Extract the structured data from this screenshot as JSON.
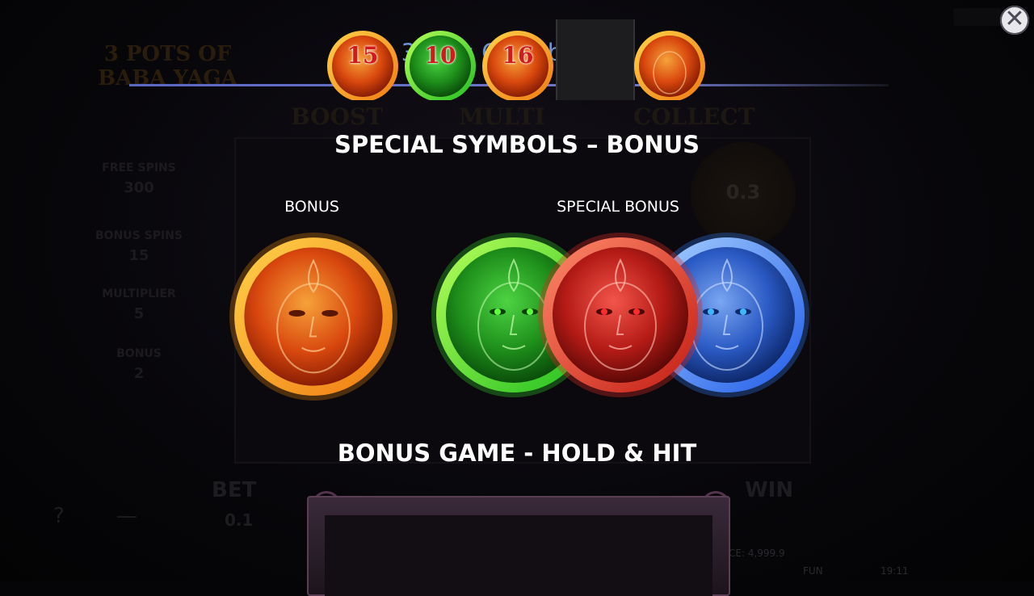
{
  "modal": {
    "title": "3 Pots Of BabaYaga",
    "close_icon": "close-icon",
    "section_title": "SPECIAL SYMBOLS – BONUS",
    "bonus_label": "BONUS",
    "special_bonus_label": "SPECIAL BONUS",
    "bonus_game_title": "BONUS GAME - HOLD & HIT",
    "symbols": [
      {
        "name": "bonus-coin-orange",
        "color": "#f08a12"
      },
      {
        "name": "special-bonus-coin-green",
        "color": "#2fc42a"
      },
      {
        "name": "special-bonus-coin-red",
        "color": "#d62a22"
      },
      {
        "name": "special-bonus-coin-blue",
        "color": "#2f6fe0"
      }
    ],
    "hold_and_hit_cells": [
      {
        "type": "orange",
        "value": "15"
      },
      {
        "type": "green",
        "value": "10"
      },
      {
        "type": "orange",
        "value": "16"
      },
      {
        "type": "empty",
        "value": ""
      },
      {
        "type": "orange",
        "value": ""
      }
    ]
  },
  "background_game": {
    "logo": "3 POTS OF BABA YAGA",
    "headers": [
      "BOOST",
      "MULTI",
      "COLLECT"
    ],
    "side_panel": [
      {
        "label": "FREE SPINS",
        "value": "300"
      },
      {
        "label": "BONUS SPINS",
        "value": "15"
      },
      {
        "label": "MULTIPLIER",
        "value": "5"
      },
      {
        "label": "BONUS",
        "value": "2"
      }
    ],
    "collect_value": "0.3",
    "bet_label": "BET",
    "bet_value": "0.1",
    "win_label": "WIN",
    "balance_text": "CE: 4,999.9",
    "mode_text": "FUN",
    "clock": "19:11"
  }
}
